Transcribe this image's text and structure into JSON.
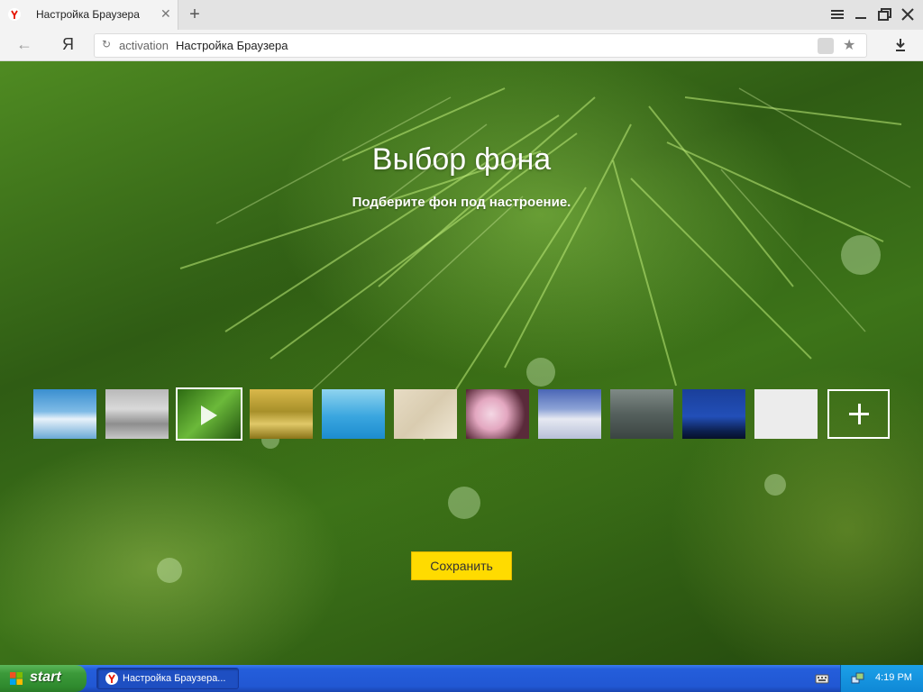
{
  "browser": {
    "tab": {
      "title": "Настройка Браузера",
      "close_icon": "close-icon"
    },
    "new_tab_icon": "plus-icon",
    "window_controls": [
      "menu-icon",
      "minimize-icon",
      "restore-icon",
      "close-icon"
    ],
    "address": {
      "protocol": "activation",
      "title": "Настройка Браузера"
    },
    "logo_letter": "Я"
  },
  "page": {
    "heading": "Выбор фона",
    "subheading": "Подберите фон под настроение.",
    "backgrounds": [
      {
        "name": "sky-clouds",
        "selected": false
      },
      {
        "name": "misty-gray",
        "selected": false
      },
      {
        "name": "green-pine-video",
        "selected": true
      },
      {
        "name": "golden-grass",
        "selected": false
      },
      {
        "name": "blue-sea",
        "selected": false
      },
      {
        "name": "sand-beige",
        "selected": false
      },
      {
        "name": "cherry-blossom",
        "selected": false
      },
      {
        "name": "snowy-mountain",
        "selected": false
      },
      {
        "name": "raindrops-glass",
        "selected": false
      },
      {
        "name": "night-forest",
        "selected": false
      },
      {
        "name": "plain-white",
        "selected": false
      }
    ],
    "add_background_icon": "plus-icon",
    "save_label": "Сохранить",
    "accent_color": "#ffdb00"
  },
  "taskbar": {
    "start_label": "start",
    "task_label": "Настройка Браузера...",
    "clock": "4:19 PM"
  }
}
